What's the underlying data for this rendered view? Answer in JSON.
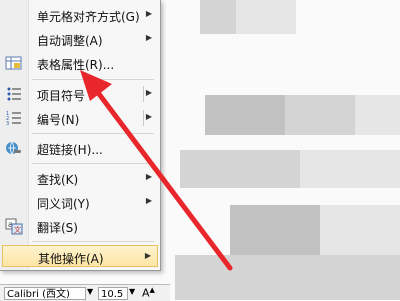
{
  "menu": {
    "items": [
      {
        "label": "单元格对齐方式(G)",
        "submenu": true
      },
      {
        "label": "自动调整(A)",
        "submenu": true
      },
      {
        "label": "表格属性(R)...",
        "icon": "table-properties-icon"
      },
      {
        "label": "项目符号",
        "submenu": true,
        "icon": "bullets-icon"
      },
      {
        "label": "编号(N)",
        "submenu": true,
        "icon": "numbering-icon"
      },
      {
        "label": "超链接(H)...",
        "icon": "hyperlink-icon"
      },
      {
        "label": "查找(K)",
        "submenu": true
      },
      {
        "label": "同义词(Y)",
        "submenu": true
      },
      {
        "label": "翻译(S)",
        "icon": "translate-icon"
      },
      {
        "label": "其他操作(A)",
        "submenu": true,
        "highlighted": true
      }
    ]
  },
  "format_bar": {
    "font_name": "Calibri (西文)",
    "font_size": "10.5"
  },
  "colors": {
    "arrow": "#e8262b",
    "highlight": "#fde5a3"
  }
}
